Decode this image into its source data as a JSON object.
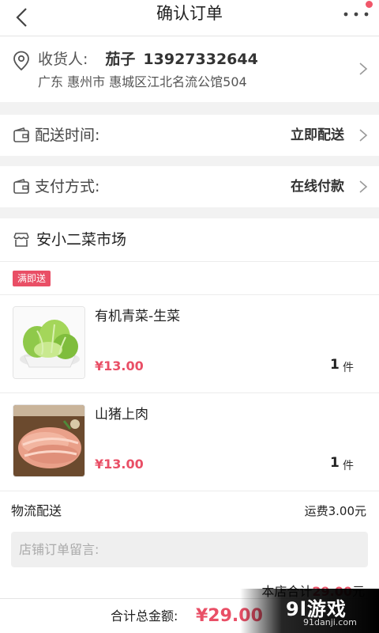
{
  "header": {
    "title": "确认订单"
  },
  "address": {
    "label": "收货人:",
    "name": "茄子",
    "phone": "13927332644",
    "detail": "广东 惠州市 惠城区江北名流公馆504"
  },
  "delivery": {
    "label": "配送时间:",
    "value": "立即配送"
  },
  "payment": {
    "label": "支付方式:",
    "value": "在线付款"
  },
  "shop": {
    "name": "安小二菜市场",
    "badge": "满即送",
    "items": [
      {
        "name": "有机青菜-生菜",
        "price": "¥13.00",
        "qty": "1",
        "unit": "件",
        "image": "lettuce"
      },
      {
        "name": "山猪上肉",
        "price": "¥13.00",
        "qty": "1",
        "unit": "件",
        "image": "pork"
      }
    ],
    "shipping_label": "物流配送",
    "shipping_fee": "运费3.00元",
    "note_placeholder": "店铺订单留言:",
    "subtotal_label": "本店合计",
    "subtotal_value": "29.00",
    "subtotal_suffix": "元"
  },
  "footer": {
    "total_label": "合计总金额:",
    "total_value": "¥29.00"
  },
  "watermark": {
    "big": "9l游戏",
    "small": "91danji.com"
  },
  "colors": {
    "accent": "#e94f66",
    "page_bg": "#f2f2f2"
  }
}
